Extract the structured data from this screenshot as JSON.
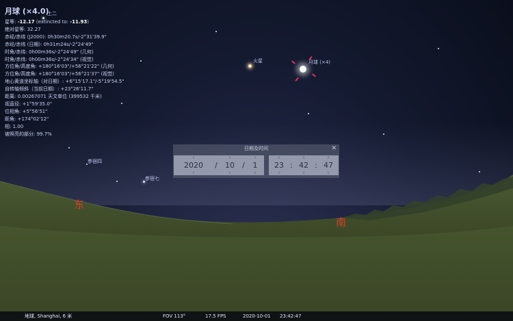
{
  "info": {
    "title": "月球 (×4.0)",
    "lines": [
      {
        "label": "星等:",
        "value": "-12.17",
        "mid": " (extincted to: ",
        "value2": "-11.93",
        "end": ")"
      },
      {
        "text": "绝对星等: 32.27"
      },
      {
        "text": "赤经/赤纬 (J2000): 0h30m20.7s/-2°31'39.9\""
      },
      {
        "text": "赤经/赤纬 (日期): 0h31m24s/-2°24'49\""
      },
      {
        "text": "时角/赤纬: 0h00m36s/-2°24'49\" (几何)"
      },
      {
        "text": "时角/赤纬: 0h00m36s/-2°24'34\" (视觉)"
      },
      {
        "text": "方位角/高度角: +180°16'03\"/+56°21'22\" (几何)"
      },
      {
        "text": "方位角/高度角: +180°16'03\"/+56°21'37\" (视觉)"
      },
      {
        "text": "地心黄道坐标轴（对日期）: +6°15'17.1\"/-5°19'54.5\""
      },
      {
        "text": "自转轴倾斜（当前日期）: +23°26'11.7\""
      },
      {
        "text": "距离: 0.00267071 天文单位 (399532 千米)"
      },
      {
        "text": "视直径: +1°59'35.0\""
      },
      {
        "text": "位相角: +5°56'51\""
      },
      {
        "text": "距角: +174°02'12\""
      },
      {
        "text": "相: 1.00"
      },
      {
        "text": "被照亮的部分: 99.7%"
      }
    ]
  },
  "sky_labels": {
    "moon": "月球 (×4)",
    "mars": "火星",
    "star_top": "土二",
    "star_shen4": "参宿四",
    "star_shen7": "参宿七"
  },
  "cardinals": {
    "east": "东",
    "south": "南"
  },
  "datetime": {
    "title": "日期及时间",
    "close": "✕",
    "year": "2020",
    "month": "10",
    "day": "1",
    "date_sep": "/",
    "hour": "23",
    "minute": "42",
    "second": "47",
    "time_sep": ":"
  },
  "status": {
    "location": "地球, Shanghai, 6 米",
    "fov": "FOV 113°",
    "fps": "17.5 FPS",
    "date": "2020-10-01",
    "time": "23:42:47"
  },
  "colors": {
    "cardinal": "#d8402a",
    "marker": "#e0305a",
    "ground_dark": "#1f2614",
    "ground_light": "#58683a"
  }
}
